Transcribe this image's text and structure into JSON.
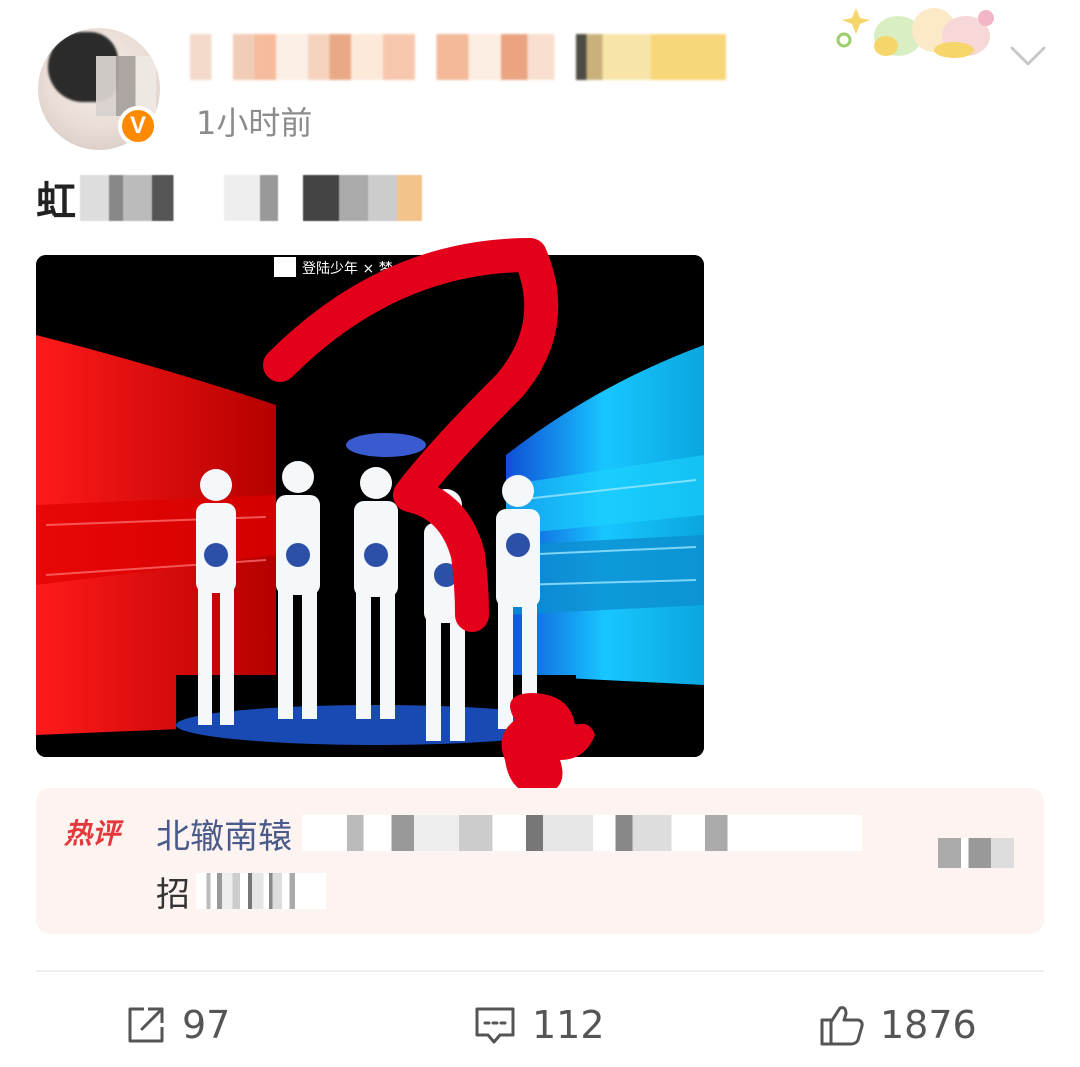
{
  "post": {
    "timestamp": "1小时前",
    "verified_badge": "V",
    "text_visible": "虹"
  },
  "hot_comment": {
    "badge": "热评",
    "author_visible": "北辙南辕",
    "text_visible": "招"
  },
  "actions": {
    "repost_count": "97",
    "comment_count": "112",
    "like_count": "1876"
  },
  "icons": {
    "chevron": "chevron-down-icon",
    "repost": "share-icon",
    "comment": "comment-icon",
    "like": "thumbs-up-icon"
  },
  "colors": {
    "verified": "#ff8a00",
    "hot_badge": "#e4393c",
    "scribble": "#e4001a",
    "author_link": "#4a5a8a"
  }
}
